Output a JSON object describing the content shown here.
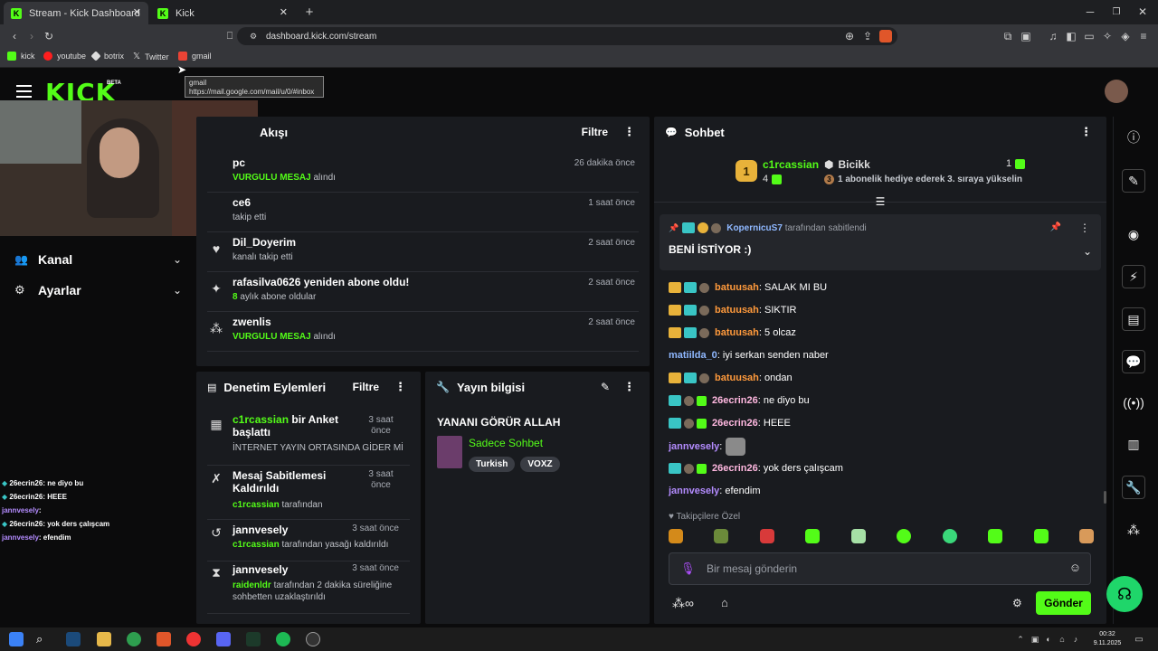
{
  "browser": {
    "tabs": [
      {
        "label": "Stream - Kick Dashboard",
        "active": true
      },
      {
        "label": "Kick",
        "active": false
      }
    ],
    "url": "dashboard.kick.com/stream",
    "bookmarks": [
      "kick",
      "youtube",
      "botrix",
      "Twitter",
      "gmail"
    ],
    "tooltip": {
      "title": "gmail",
      "url": "https://mail.google.com/mail/u/0/#inbox"
    }
  },
  "header": {
    "logo": "KICK",
    "beta": "BETA"
  },
  "sidebar": {
    "items": [
      {
        "label": "Kanal"
      },
      {
        "label": "Ayarlar"
      }
    ]
  },
  "activity": {
    "title": "Akışı",
    "filter": "Filtre",
    "items": [
      {
        "title": "pc",
        "sub_highlight": "VURGULU MESAJ",
        "sub": "alındı",
        "time": "26 dakika önce"
      },
      {
        "title": "ce6",
        "sub_highlight": "",
        "sub": "takip etti",
        "time": "1 saat önce"
      },
      {
        "title": "Dil_Doyerim",
        "sub_highlight": "",
        "sub": "kanalı takip etti",
        "time": "2 saat önce"
      },
      {
        "title": "rafasilva0626 yeniden abone oldu!",
        "sub_highlight": "8",
        "sub": "aylık abone oldular",
        "time": "2 saat önce"
      },
      {
        "title": "zwenlis",
        "sub_highlight": "VURGULU MESAJ",
        "sub": "alındı",
        "time": "2 saat önce"
      }
    ]
  },
  "moderation": {
    "title": "Denetim Eylemleri",
    "filter": "Filtre",
    "items": [
      {
        "user": "c1rcassian",
        "title": "bir Anket başlattı",
        "sub_user": "",
        "sub": "İNTERNET YAYIN ORTASINDA GİDER Mİ",
        "time": "3 saat önce"
      },
      {
        "user": "",
        "title": "Mesaj Sabitlemesi Kaldırıldı",
        "sub_user": "c1rcassian",
        "sub": "tarafından",
        "time": "3 saat önce"
      },
      {
        "user": "",
        "title": "jannvesely",
        "sub_user": "c1rcassian",
        "sub": "tarafından yasağı kaldırıldı",
        "time": "3 saat önce"
      },
      {
        "user": "",
        "title": "jannvesely",
        "sub_user": "raidenldr",
        "sub": "tarafından 2 dakika süreliğine sohbetten uzaklaştırıldı",
        "time": "3 saat önce"
      }
    ]
  },
  "stream_info": {
    "title": "Yayın bilgisi",
    "stream_title": "YANANI GÖRÜR ALLAH",
    "category": "Sadece Sohbet",
    "tags": [
      "Turkish",
      "VOXZ"
    ]
  },
  "chat": {
    "title": "Sohbet",
    "leader": {
      "rank": "1",
      "name": "c1rcassian",
      "count": "4",
      "gifter": "Bicikk",
      "gifter_count": "1",
      "gift_rank": "3",
      "gift_text": "1 abonelik hediye ederek 3. sıraya yükselin"
    },
    "pinned": {
      "by_user": "KopernicuS7",
      "by_text": "tarafından sabitlendi",
      "message": "BENİ İSTİYOR :)"
    },
    "messages": [
      {
        "user": "batuusah",
        "text": ": SALAK MI BU",
        "style": "orange"
      },
      {
        "user": "batuusah",
        "text": ": SIKTIR",
        "style": "orange"
      },
      {
        "user": "batuusah",
        "text": ": 5 olcaz",
        "style": "orange"
      },
      {
        "user": "matiilda_0",
        "text": ": iyi serkan senden naber",
        "style": "blue"
      },
      {
        "user": "batuusah",
        "text": ": ondan",
        "style": "orange"
      },
      {
        "user": "26ecrin26",
        "text": ": ne diyo bu",
        "style": "pink"
      },
      {
        "user": "26ecrin26",
        "text": ": HEEE",
        "style": "pink"
      },
      {
        "user": "jannvesely",
        "text": ":",
        "style": "purple"
      },
      {
        "user": "26ecrin26",
        "text": ": yok ders çalışcam",
        "style": "pink"
      },
      {
        "user": "jannvesely",
        "text": ": efendim",
        "style": "purple"
      }
    ],
    "emote_label": "Takipçilere Özel",
    "input_placeholder": "Bir mesaj gönderin",
    "send_label": "Gönder"
  },
  "overlay_chat": [
    {
      "user": "26ecrin26",
      "text": ": ne diyo bu"
    },
    {
      "user": "26ecrin26",
      "text": ": HEEE"
    },
    {
      "user": "jannvesely",
      "text": ":"
    },
    {
      "user": "26ecrin26",
      "text": ": yok ders çalışcam"
    },
    {
      "user": "jannvesely",
      "text": ": efendim"
    }
  ],
  "taskbar": {
    "time": "00:32",
    "date": "9.11.2025"
  },
  "colors": {
    "accent": "#53fc18",
    "panel": "#191b1f",
    "background": "#0b0b0c"
  }
}
